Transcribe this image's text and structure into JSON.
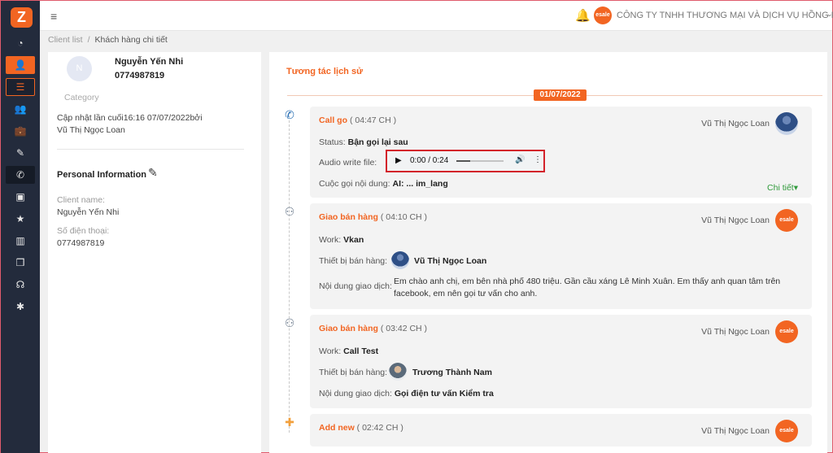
{
  "brand": {
    "logo_letter": "Z",
    "accent": "#f26522",
    "sidebar_bg": "#232b3c"
  },
  "sidebar": {
    "items": [
      {
        "name": "dashboard-icon",
        "glyph": "◔"
      },
      {
        "name": "customer-icon",
        "glyph": "👤"
      },
      {
        "name": "list-icon",
        "glyph": "☰"
      },
      {
        "name": "users-icon",
        "glyph": "👥"
      },
      {
        "name": "briefcase-icon",
        "glyph": "💼"
      },
      {
        "name": "edit-note-icon",
        "glyph": "✎"
      },
      {
        "name": "phone-icon",
        "glyph": "✆"
      },
      {
        "name": "contact-book-icon",
        "glyph": "▣"
      },
      {
        "name": "star-icon",
        "glyph": "★"
      },
      {
        "name": "chart-icon",
        "glyph": "▥"
      },
      {
        "name": "box-icon",
        "glyph": "❒"
      },
      {
        "name": "support-icon",
        "glyph": "☊"
      },
      {
        "name": "settings-icon",
        "glyph": "✱"
      }
    ]
  },
  "topbar": {
    "menu_icon": "≡",
    "bell_icon": "🔔",
    "company_avatar_text": "esale",
    "company_name": "CÔNG TY TNHH THƯƠNG MẠI VÀ DỊCH VỤ HỒNG PHÁT",
    "caret": "⌄"
  },
  "breadcrumb": {
    "items": [
      "Client list",
      "Khách hàng chi tiết"
    ],
    "separator": "/"
  },
  "customer": {
    "avatar_letter": "N",
    "name": "Nguyễn Yến Nhi",
    "phone": "0774987819",
    "category_label": "Category",
    "updated_line": "Cập nhật lần cuối16:16 07/07/2022bởi",
    "updated_by": "Vũ Thị Ngọc Loan",
    "personal_info_title": "Personal Information",
    "fields": [
      {
        "label": "Client name:",
        "value": "Nguyễn Yến Nhi"
      },
      {
        "label": "Số điện thoại:",
        "value": "0774987819"
      }
    ]
  },
  "history": {
    "title": "Tương tác lịch sử",
    "date": "01/07/2022",
    "cards": [
      {
        "type": "Call go",
        "time": "( 04:47 CH )",
        "user": "Vũ Thị Ngọc Loan",
        "status_label": "Status:",
        "status_value": "Bận gọi lại sau",
        "audio_label": "Audio write file:",
        "audio_time": "0:00 / 0:24",
        "audio_progress": 0.3,
        "content_label": "Cuộc gọi nội dung:",
        "content_value": "AI: ... im_lang",
        "detail_link": "Chi tiết"
      },
      {
        "type": "Giao bán hàng",
        "time": "( 04:10 CH )",
        "user": "Vũ Thị Ngọc Loan",
        "user_avatar_text": "esale",
        "work_label": "Work:",
        "work_value": "Vkan",
        "device_label": "Thiết bị bán hàng:",
        "device_value": "Vũ Thị Ngọc Loan",
        "content_label": "Nội dung giao dịch:",
        "content_value": "Em chào anh chị, em bên nhà phố 480 triệu. Gần cầu xáng Lê Minh Xuân. Em thấy anh quan tâm trên facebook, em nên gọi tư vấn cho anh."
      },
      {
        "type": "Giao bán hàng",
        "time": "( 03:42 CH )",
        "user": "Vũ Thị Ngọc Loan",
        "user_avatar_text": "esale",
        "work_label": "Work:",
        "work_value": "Call Test",
        "device_label": "Thiết bị bán hàng:",
        "device_value": "Trương Thành Nam",
        "content_label": "Nội dung giao dịch:",
        "content_value": "Gọi điện tư vấn Kiểm tra"
      },
      {
        "type": "Add new",
        "time": "( 02:42 CH )",
        "user": "Vũ Thị Ngọc Loan",
        "user_avatar_text": "esale"
      }
    ]
  }
}
